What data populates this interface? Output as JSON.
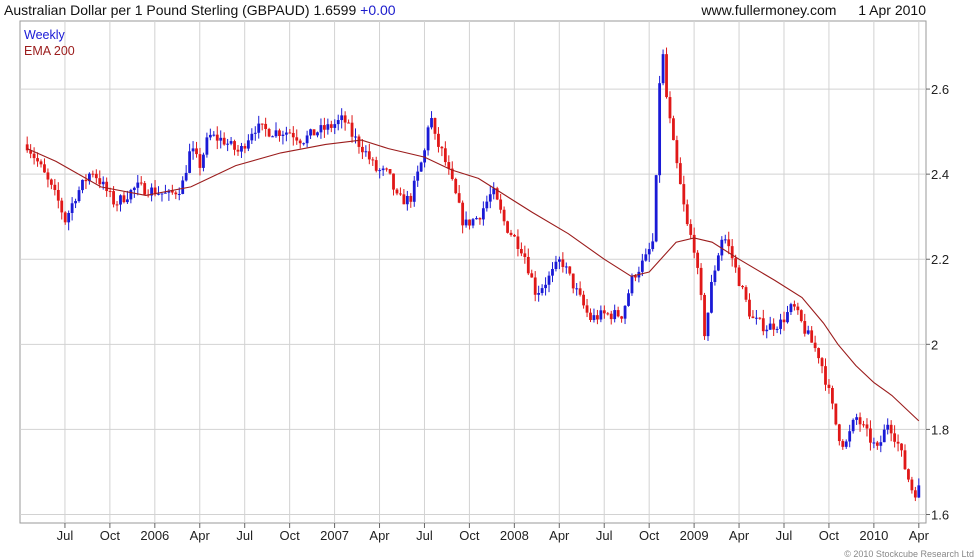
{
  "header": {
    "title": "Australian Dollar per 1 Pound Sterling (GBPAUD)",
    "last_value": "1.6599",
    "change": "+0.00",
    "website": "www.fullermoney.com",
    "date": "1 Apr 2010"
  },
  "footer": {
    "copyright": "© 2010 Stockcube Research Ltd"
  },
  "colors": {
    "up": "#1a1ad6",
    "down": "#e01818",
    "ema": "#9b1c1c",
    "grid": "#d2d2d2",
    "frame": "#9a9a9a"
  },
  "chart_data": {
    "type": "line",
    "subtype": "weekly-candlestick-with-moving-average",
    "ylim": [
      1.58,
      2.76
    ],
    "y_ticks": [
      "1.6",
      "1.8",
      "2",
      "2.2",
      "2.4",
      "2.6"
    ],
    "x_ticks": [
      "Jul",
      "Oct",
      "2006",
      "Apr",
      "Jul",
      "Oct",
      "2007",
      "Apr",
      "Jul",
      "Oct",
      "2008",
      "Apr",
      "Jul",
      "Oct",
      "2009",
      "Apr",
      "Jul",
      "Oct",
      "2010",
      "Apr"
    ],
    "grid": true,
    "legend": [
      {
        "label": "Weekly",
        "color": "#1a1ad6"
      },
      {
        "label": "EMA 200",
        "color": "#9b1c1c"
      }
    ],
    "series": [
      {
        "name": "Weekly",
        "price_path": [
          [
            2005.29,
            2.47
          ],
          [
            2005.36,
            2.42
          ],
          [
            2005.42,
            2.37
          ],
          [
            2005.47,
            2.33
          ],
          [
            2005.5,
            2.29
          ],
          [
            2005.56,
            2.35
          ],
          [
            2005.65,
            2.41
          ],
          [
            2005.7,
            2.38
          ],
          [
            2005.78,
            2.33
          ],
          [
            2005.9,
            2.37
          ],
          [
            2006.0,
            2.36
          ],
          [
            2006.08,
            2.35
          ],
          [
            2006.15,
            2.37
          ],
          [
            2006.2,
            2.46
          ],
          [
            2006.25,
            2.42
          ],
          [
            2006.3,
            2.49
          ],
          [
            2006.38,
            2.48
          ],
          [
            2006.47,
            2.45
          ],
          [
            2006.55,
            2.51
          ],
          [
            2006.65,
            2.5
          ],
          [
            2006.75,
            2.5
          ],
          [
            2006.82,
            2.48
          ],
          [
            2006.9,
            2.5
          ],
          [
            2006.97,
            2.51
          ],
          [
            2007.05,
            2.53
          ],
          [
            2007.1,
            2.49
          ],
          [
            2007.16,
            2.46
          ],
          [
            2007.23,
            2.41
          ],
          [
            2007.3,
            2.4
          ],
          [
            2007.35,
            2.34
          ],
          [
            2007.42,
            2.34
          ],
          [
            2007.5,
            2.45
          ],
          [
            2007.53,
            2.55
          ],
          [
            2007.56,
            2.48
          ],
          [
            2007.6,
            2.45
          ],
          [
            2007.66,
            2.37
          ],
          [
            2007.72,
            2.28
          ],
          [
            2007.8,
            2.3
          ],
          [
            2007.88,
            2.36
          ],
          [
            2007.95,
            2.28
          ],
          [
            2008.05,
            2.22
          ],
          [
            2008.12,
            2.12
          ],
          [
            2008.2,
            2.16
          ],
          [
            2008.26,
            2.2
          ],
          [
            2008.35,
            2.12
          ],
          [
            2008.42,
            2.06
          ],
          [
            2008.5,
            2.07
          ],
          [
            2008.6,
            2.07
          ],
          [
            2008.66,
            2.16
          ],
          [
            2008.73,
            2.2
          ],
          [
            2008.78,
            2.25
          ],
          [
            2008.8,
            2.55
          ],
          [
            2008.82,
            2.72
          ],
          [
            2008.84,
            2.6
          ],
          [
            2008.88,
            2.48
          ],
          [
            2008.92,
            2.38
          ],
          [
            2008.96,
            2.28
          ],
          [
            2009.0,
            2.23
          ],
          [
            2009.04,
            2.1
          ],
          [
            2009.06,
            2.02
          ],
          [
            2009.1,
            2.15
          ],
          [
            2009.16,
            2.26
          ],
          [
            2009.2,
            2.22
          ],
          [
            2009.25,
            2.15
          ],
          [
            2009.32,
            2.06
          ],
          [
            2009.4,
            2.04
          ],
          [
            2009.48,
            2.05
          ],
          [
            2009.55,
            2.09
          ],
          [
            2009.62,
            2.03
          ],
          [
            2009.7,
            1.97
          ],
          [
            2009.76,
            1.87
          ],
          [
            2009.8,
            1.79
          ],
          [
            2009.84,
            1.76
          ],
          [
            2009.9,
            1.83
          ],
          [
            2009.96,
            1.79
          ],
          [
            2010.02,
            1.75
          ],
          [
            2010.08,
            1.82
          ],
          [
            2010.14,
            1.76
          ],
          [
            2010.18,
            1.7
          ],
          [
            2010.22,
            1.65
          ],
          [
            2010.25,
            1.66
          ]
        ]
      },
      {
        "name": "EMA 200",
        "path": [
          [
            2005.29,
            2.46
          ],
          [
            2005.45,
            2.43
          ],
          [
            2005.7,
            2.37
          ],
          [
            2005.95,
            2.35
          ],
          [
            2006.2,
            2.37
          ],
          [
            2006.45,
            2.42
          ],
          [
            2006.7,
            2.45
          ],
          [
            2006.95,
            2.47
          ],
          [
            2007.15,
            2.48
          ],
          [
            2007.3,
            2.46
          ],
          [
            2007.5,
            2.44
          ],
          [
            2007.65,
            2.41
          ],
          [
            2007.8,
            2.39
          ],
          [
            2007.95,
            2.35
          ],
          [
            2008.1,
            2.31
          ],
          [
            2008.3,
            2.26
          ],
          [
            2008.5,
            2.2
          ],
          [
            2008.65,
            2.16
          ],
          [
            2008.75,
            2.17
          ],
          [
            2008.9,
            2.24
          ],
          [
            2009.0,
            2.25
          ],
          [
            2009.1,
            2.24
          ],
          [
            2009.25,
            2.2
          ],
          [
            2009.45,
            2.15
          ],
          [
            2009.6,
            2.11
          ],
          [
            2009.72,
            2.05
          ],
          [
            2009.8,
            2.0
          ],
          [
            2009.9,
            1.95
          ],
          [
            2010.0,
            1.91
          ],
          [
            2010.1,
            1.88
          ],
          [
            2010.25,
            1.82
          ]
        ]
      }
    ]
  }
}
